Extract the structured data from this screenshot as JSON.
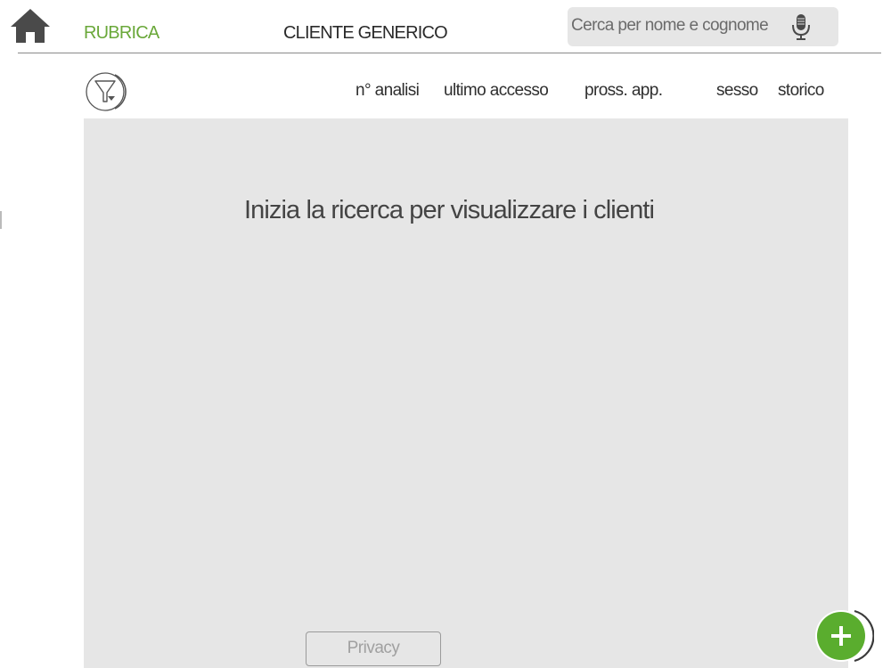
{
  "header": {
    "home_icon": "home-icon",
    "tabs": [
      {
        "label": "RUBRICA",
        "active": true
      },
      {
        "label": "CLIENTE GENERICO",
        "active": false
      }
    ],
    "search": {
      "placeholder": "Cerca per nome e cognome",
      "value": "",
      "icon": "microphone-icon"
    }
  },
  "list_header": {
    "filter_icon": "filter-icon",
    "columns": [
      {
        "label": "n° analisi"
      },
      {
        "label": "ultimo accesso"
      },
      {
        "label": "pross. app."
      },
      {
        "label": "sesso"
      },
      {
        "label": "storico"
      }
    ]
  },
  "content": {
    "empty_message": "Inizia la ricerca per visualizzare i clienti"
  },
  "footer": {
    "privacy_label": "Privacy",
    "add_icon": "plus-icon"
  },
  "colors": {
    "accent": "#6aa83a",
    "fab_green": "#5aad2e",
    "panel_bg": "#e6e6e6",
    "text_dark": "#333333"
  }
}
